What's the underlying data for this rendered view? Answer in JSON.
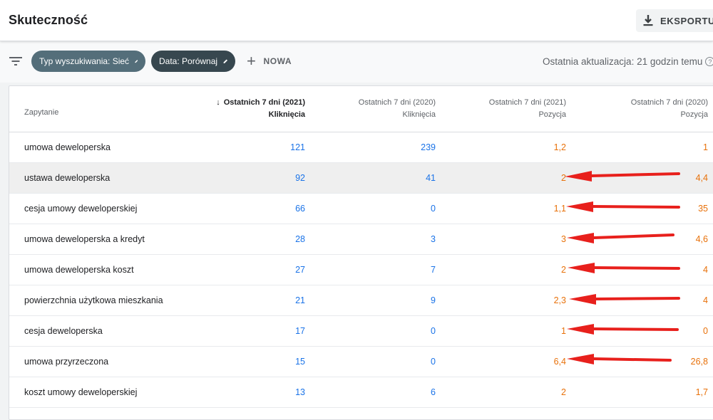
{
  "header": {
    "title": "Skuteczność",
    "export_label": "EKSPORTUJ"
  },
  "filters": {
    "type_chip": "Typ wyszukiwania: Sieć",
    "date_chip": "Data: Porównaj",
    "new_label": "NOWA",
    "last_update": "Ostatnia aktualizacja: 21 godzin temu",
    "help_glyph": "?"
  },
  "table": {
    "columns": [
      {
        "period": "",
        "metric": "Zapytanie"
      },
      {
        "period": "Ostatnich 7 dni (2021)",
        "metric": "Kliknięcia",
        "sorted": true
      },
      {
        "period": "Ostatnich 7 dni (2020)",
        "metric": "Kliknięcia"
      },
      {
        "period": "Ostatnich 7 dni (2021)",
        "metric": "Pozycja"
      },
      {
        "period": "Ostatnich 7 dni (2020)",
        "metric": "Pozycja"
      }
    ],
    "rows": [
      {
        "query": "umowa deweloperska",
        "clicks_2021": "121",
        "clicks_2020": "239",
        "pos_2021": "1,2",
        "pos_2020": "1"
      },
      {
        "query": "ustawa deweloperska",
        "clicks_2021": "92",
        "clicks_2020": "41",
        "pos_2021": "2",
        "pos_2020": "4,4",
        "highlighted": true
      },
      {
        "query": "cesja umowy deweloperskiej",
        "clicks_2021": "66",
        "clicks_2020": "0",
        "pos_2021": "1,1",
        "pos_2020": "35"
      },
      {
        "query": "umowa deweloperska a kredyt",
        "clicks_2021": "28",
        "clicks_2020": "3",
        "pos_2021": "3",
        "pos_2020": "4,6"
      },
      {
        "query": "umowa deweloperska koszt",
        "clicks_2021": "27",
        "clicks_2020": "7",
        "pos_2021": "2",
        "pos_2020": "4"
      },
      {
        "query": "powierzchnia użytkowa mieszkania",
        "clicks_2021": "21",
        "clicks_2020": "9",
        "pos_2021": "2,3",
        "pos_2020": "4"
      },
      {
        "query": "cesja deweloperska",
        "clicks_2021": "17",
        "clicks_2020": "0",
        "pos_2021": "1",
        "pos_2020": "0"
      },
      {
        "query": "umowa przyrzeczona",
        "clicks_2021": "15",
        "clicks_2020": "0",
        "pos_2021": "6,4",
        "pos_2020": "26,8"
      },
      {
        "query": "koszt umowy deweloperskiej",
        "clicks_2021": "13",
        "clicks_2020": "6",
        "pos_2021": "2",
        "pos_2020": "1,7"
      }
    ]
  },
  "colors": {
    "clicks": "#1a73e8",
    "position": "#e8710a",
    "annotation_arrow": "#e8201c"
  },
  "annotations": {
    "arrow_rows": [
      1,
      2,
      3,
      4,
      5,
      6,
      7
    ]
  }
}
